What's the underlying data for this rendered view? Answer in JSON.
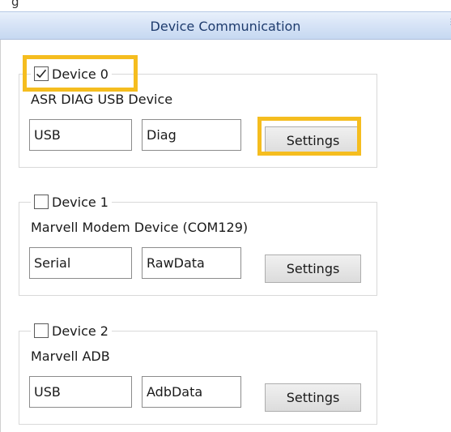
{
  "top_cut_text": "g",
  "panel": {
    "title": "Device Communication",
    "grip_icon": "vertical-dots-grip"
  },
  "highlight_color": "#f5bd1f",
  "devices": [
    {
      "checkbox_label": "Device 0",
      "checked": true,
      "name": "ASR DIAG USB Device",
      "interface": "USB",
      "data_type": "Diag",
      "settings_label": "Settings"
    },
    {
      "checkbox_label": "Device 1",
      "checked": false,
      "name": "Marvell Modem Device (COM129)",
      "interface": "Serial",
      "data_type": "RawData",
      "settings_label": "Settings"
    },
    {
      "checkbox_label": "Device 2",
      "checked": false,
      "name": "Marvell ADB",
      "interface": "USB",
      "data_type": "AdbData",
      "settings_label": "Settings"
    }
  ]
}
